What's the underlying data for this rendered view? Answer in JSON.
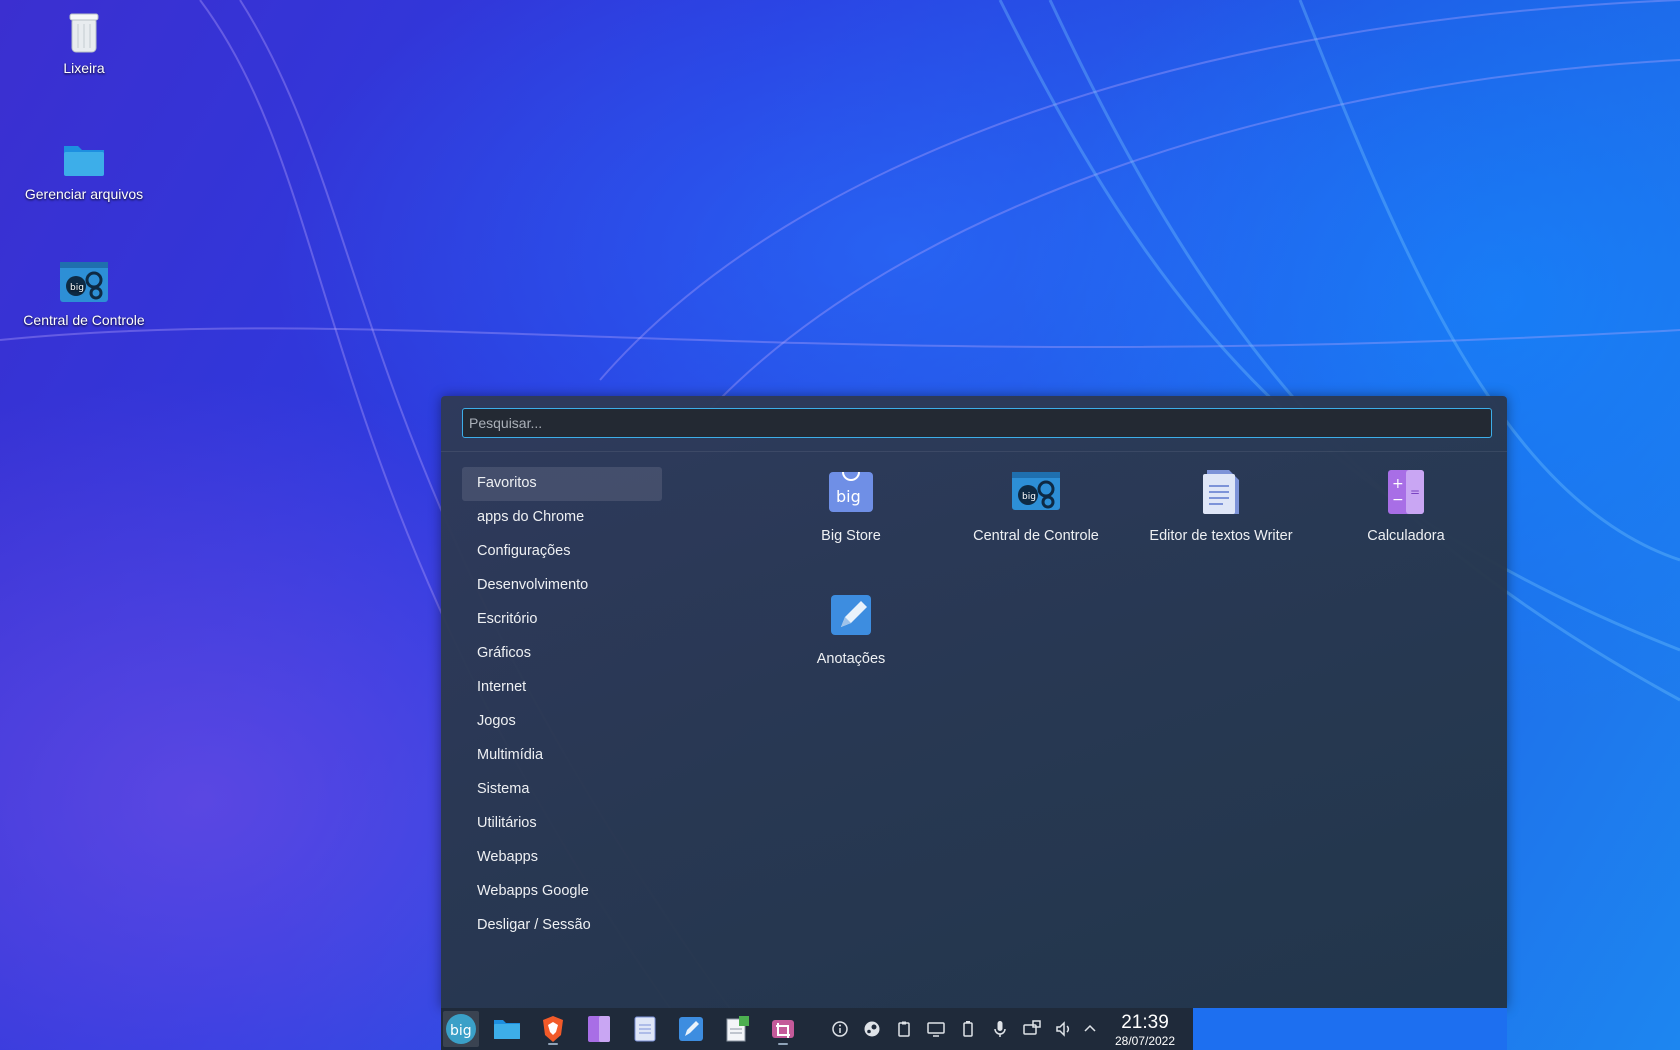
{
  "desktop": {
    "icons": [
      {
        "label": "Lixeira",
        "icon": "trash-icon"
      },
      {
        "label": "Gerenciar arquivos",
        "icon": "folder-icon"
      },
      {
        "label": "Central de Controle",
        "icon": "control-center-icon"
      }
    ]
  },
  "launcher": {
    "search": {
      "placeholder": "Pesquisar...",
      "value": ""
    },
    "categories": [
      "Favoritos",
      "apps do Chrome",
      "Configurações",
      "Desenvolvimento",
      "Escritório",
      "Gráficos",
      "Internet",
      "Jogos",
      "Multimídia",
      "Sistema",
      "Utilitários",
      "Webapps",
      "Webapps Google",
      "Desligar / Sessão"
    ],
    "active_category": "Favoritos",
    "apps": [
      {
        "label": "Big Store",
        "icon": "big-store-icon"
      },
      {
        "label": "Central de Controle",
        "icon": "control-center-icon"
      },
      {
        "label": "Editor de textos Writer",
        "icon": "writer-icon"
      },
      {
        "label": "Calculadora",
        "icon": "calculator-icon"
      },
      {
        "label": "Anotações",
        "icon": "notes-icon"
      }
    ]
  },
  "taskbar": {
    "launchers": [
      "launcher-menu-icon",
      "file-manager-icon",
      "brave-browser-icon",
      "calculator-icon",
      "writer-icon",
      "notes-icon",
      "document-viewer-icon",
      "screenshot-icon"
    ],
    "tray": [
      "info-icon",
      "steam-icon",
      "clipboard-icon",
      "display-icon",
      "battery-icon",
      "microphone-icon",
      "network-icon",
      "volume-icon",
      "chevron-up-icon"
    ],
    "clock": {
      "time": "21:39",
      "date": "28/07/2022"
    }
  },
  "colors": {
    "accent": "#3daee9",
    "panel": "#1f2a3a",
    "launcher_bg": "#2f3a58"
  }
}
